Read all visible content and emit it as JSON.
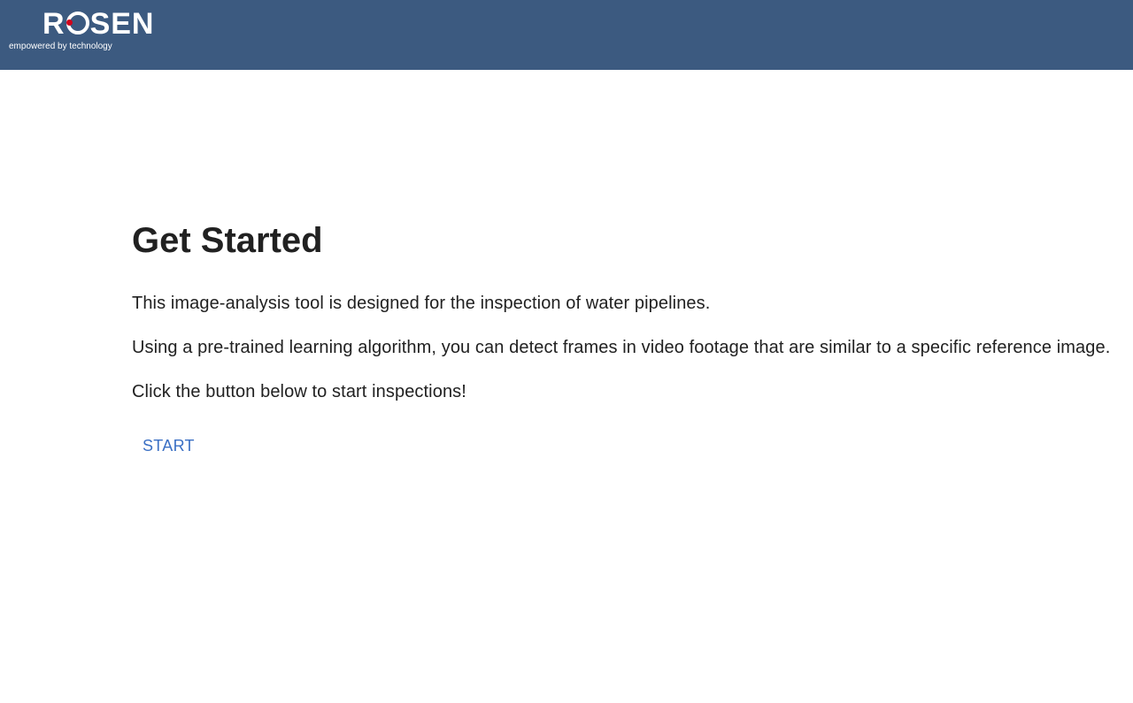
{
  "header": {
    "logo_text": "ROSEN",
    "tagline": "empowered by technology",
    "bar_color": "#3c5a80",
    "logo_dot_color": "#d0021b"
  },
  "main": {
    "title": "Get Started",
    "paragraphs": [
      "This image-analysis tool is designed for the inspection of water pipelines.",
      "Using a pre-trained learning algorithm, you can detect frames in video footage that are similar to a specific reference image.",
      "Click the button below to start inspections!"
    ],
    "start_label": "START",
    "accent_color": "#3a6fc4"
  }
}
